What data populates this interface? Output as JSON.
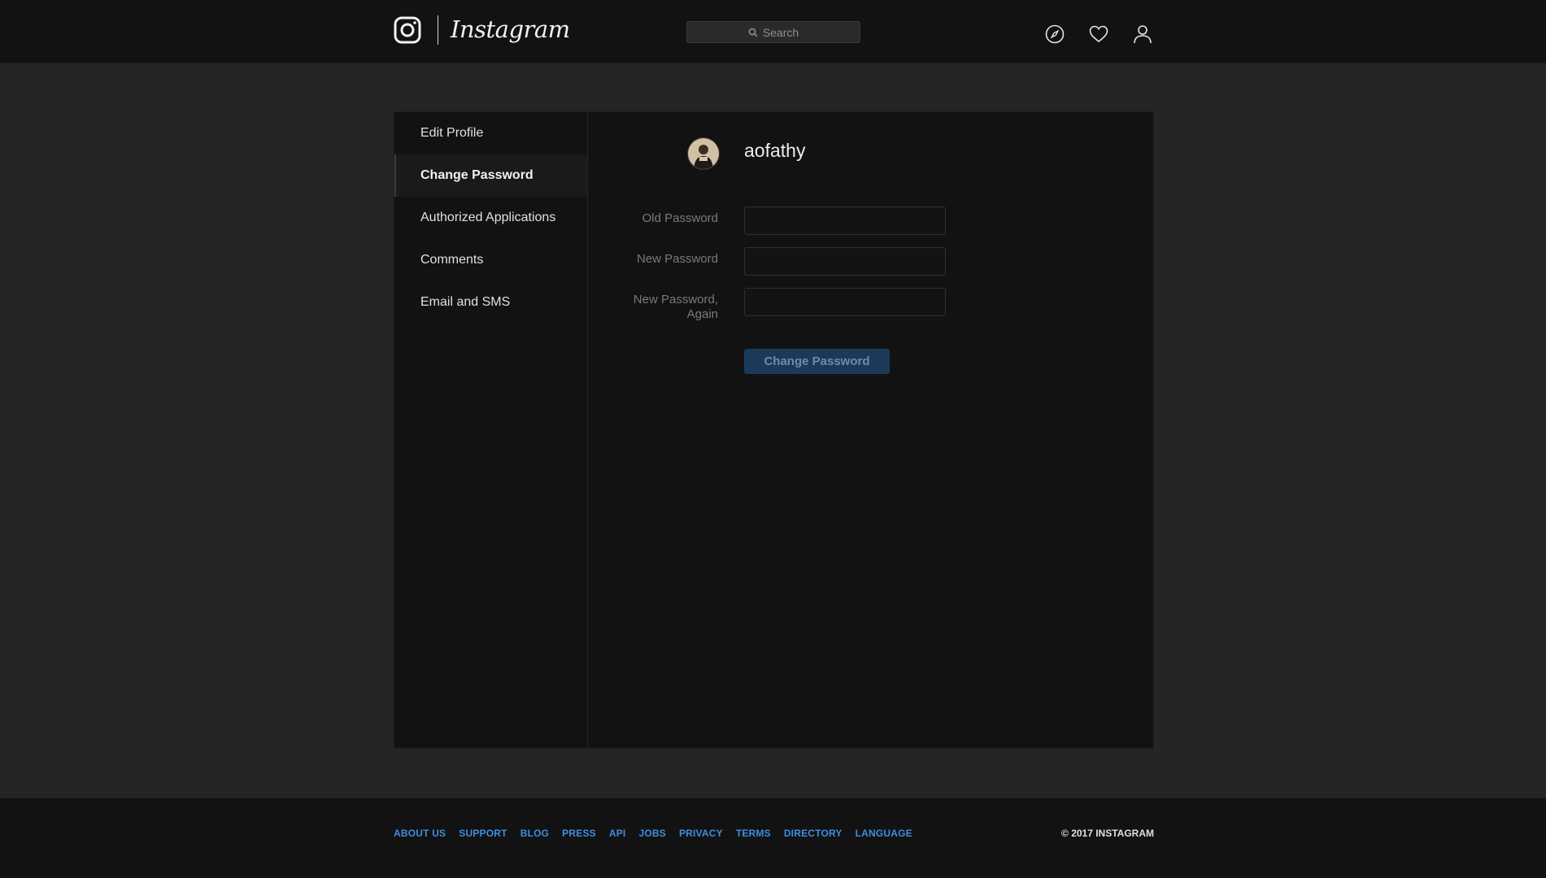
{
  "header": {
    "brand": "Instagram",
    "search_placeholder": "Search"
  },
  "sidebar": {
    "items": [
      {
        "label": "Edit Profile"
      },
      {
        "label": "Change Password"
      },
      {
        "label": "Authorized Applications"
      },
      {
        "label": "Comments"
      },
      {
        "label": "Email and SMS"
      }
    ],
    "active_index": 1
  },
  "main": {
    "username": "aofathy",
    "fields": [
      {
        "label": "Old Password",
        "value": ""
      },
      {
        "label": "New Password",
        "value": ""
      },
      {
        "label": "New Password, Again",
        "value": ""
      }
    ],
    "submit_label": "Change Password"
  },
  "footer": {
    "links": [
      "ABOUT US",
      "SUPPORT",
      "BLOG",
      "PRESS",
      "API",
      "JOBS",
      "PRIVACY",
      "TERMS",
      "DIRECTORY",
      "LANGUAGE"
    ],
    "copyright": "© 2017 INSTAGRAM"
  },
  "colors": {
    "background": "#252525",
    "panel": "#121212",
    "link": "#3d8fe0",
    "button": "#1b3a5a"
  }
}
